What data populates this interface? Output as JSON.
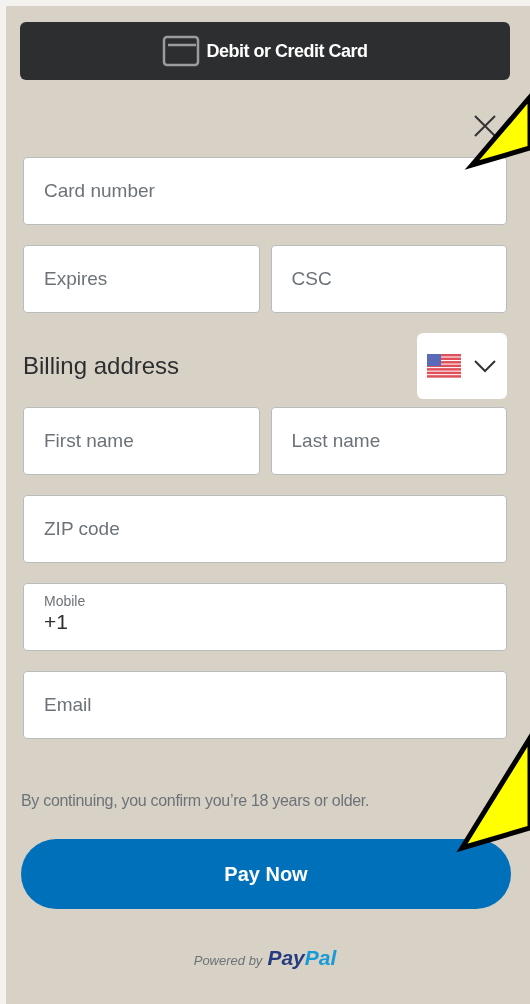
{
  "payment_method": {
    "label": "Debit or Credit Card"
  },
  "card": {
    "rows": [
      [
        {
          "placeholder": "Card number"
        }
      ],
      [
        {
          "placeholder": "Expires"
        },
        {
          "placeholder": "CSC"
        }
      ]
    ]
  },
  "billing": {
    "heading": "Billing address",
    "country_select": {
      "expanded": false
    },
    "rows": [
      [
        {
          "placeholder": "First name"
        },
        {
          "placeholder": "Last name"
        }
      ],
      [
        {
          "placeholder": "ZIP code"
        }
      ],
      [
        {
          "label": "Mobile",
          "value": "+1"
        }
      ],
      [
        {
          "placeholder": "Email"
        }
      ]
    ]
  },
  "disclaimer": "By continuing, you confirm you’re 18 years or older.",
  "submit": {
    "label": "Pay Now"
  },
  "footer": {
    "prefix": "Powered by",
    "brand": [
      {
        "text": "Pay",
        "color": "#253b80"
      },
      {
        "text": "Pal",
        "color": "#179bd7"
      }
    ]
  }
}
